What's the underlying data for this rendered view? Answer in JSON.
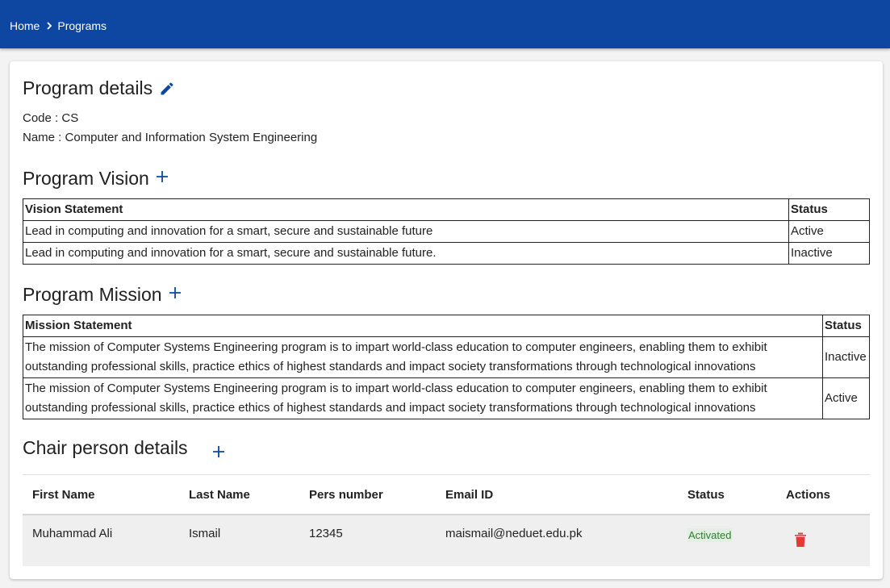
{
  "breadcrumb": {
    "home": "Home",
    "current": "Programs",
    "separator_icon": "chevron-right-icon"
  },
  "program_details": {
    "title": "Program details",
    "edit_icon": "pencil-icon",
    "code_line": "Code : CS",
    "name_line": "Name : Computer and Information System Engineering"
  },
  "vision": {
    "title": "Program Vision",
    "add_icon": "plus-icon",
    "headers": [
      "Vision Statement",
      "Status"
    ],
    "rows": [
      {
        "statement": "Lead in computing and innovation for a smart, secure and sustainable future",
        "status": "Active"
      },
      {
        "statement": "Lead in computing and innovation for a smart, secure and sustainable future.",
        "status": "Inactive"
      }
    ]
  },
  "mission": {
    "title": "Program Mission",
    "add_icon": "plus-icon",
    "headers": [
      "Mission Statement",
      "Status"
    ],
    "rows": [
      {
        "statement": "The mission of Computer Systems Engineering program is to impart world-class education to computer engineers, enabling them to exhibit outstanding professional skills, practice ethics of highest standards and impact society transformations through technological innovations",
        "status": "Inactive"
      },
      {
        "statement": "The mission of Computer Systems Engineering program is to impart world-class education to computer engineers, enabling them to exhibit outstanding professional skills, practice ethics of highest standards and impact society transformations through technological innovations",
        "status": "Active"
      }
    ]
  },
  "chair": {
    "title": "Chair person details",
    "add_icon": "plus-icon",
    "headers": [
      "First Name",
      "Last Name",
      "Pers number",
      "Email ID",
      "Status",
      "Actions"
    ],
    "rows": [
      {
        "first_name": "Muhammad Ali",
        "last_name": "Ismail",
        "pers_number": "12345",
        "email": "maismail@neduet.edu.pk",
        "status": "Activated",
        "action_icon": "trash-icon"
      }
    ]
  },
  "colors": {
    "header_bg": "#0d47a1",
    "accent": "#0d47a1",
    "status_active_text": "#2e7d32",
    "status_active_bg": "#e3efe2",
    "delete": "#e53935"
  }
}
